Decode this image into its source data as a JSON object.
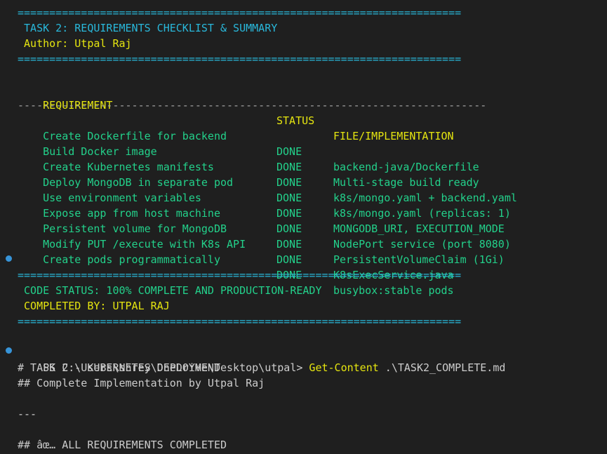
{
  "colors": {
    "background": "#1f1f1f",
    "cyan": "#29b8db",
    "yellow": "#e5e510",
    "green": "#23d18b",
    "text": "#cccccc",
    "dot": "#3794d8"
  },
  "banner": {
    "separator": "======================================================================",
    "title": " TASK 2: REQUIREMENTS CHECKLIST & SUMMARY",
    "author": " Author: Utpal Raj"
  },
  "table": {
    "headers": {
      "requirement": "REQUIREMENT",
      "status": "STATUS",
      "file": "FILE/IMPLEMENTATION"
    },
    "divider": "--------------------------------------------------------------------------",
    "rows": [
      {
        "requirement": "Create Dockerfile for backend",
        "status": "DONE",
        "file": "backend-java/Dockerfile"
      },
      {
        "requirement": "Build Docker image",
        "status": "DONE",
        "file": "Multi-stage build ready"
      },
      {
        "requirement": "Create Kubernetes manifests",
        "status": "DONE",
        "file": "k8s/mongo.yaml + backend.yaml"
      },
      {
        "requirement": "Deploy MongoDB in separate pod",
        "status": "DONE",
        "file": "k8s/mongo.yaml (replicas: 1)"
      },
      {
        "requirement": "Use environment variables",
        "status": "DONE",
        "file": "MONGODB_URI, EXECUTION_MODE"
      },
      {
        "requirement": "Expose app from host machine",
        "status": "DONE",
        "file": "NodePort service (port 8080)"
      },
      {
        "requirement": "Persistent volume for MongoDB",
        "status": "DONE",
        "file": "PersistentVolumeClaim (1Gi)"
      },
      {
        "requirement": "Modify PUT /execute with K8s API",
        "status": "DONE",
        "file": "K8sExecService.java"
      },
      {
        "requirement": "Create pods programmatically",
        "status": "DONE",
        "file": "busybox:stable pods"
      }
    ]
  },
  "summary": {
    "separator": "======================================================================",
    "code_status": " CODE STATUS: 100% COMPLETE AND PRODUCTION-READY",
    "completed_by": " COMPLETED BY: UTPAL RAJ"
  },
  "prompt": {
    "path": "PS C:\\Users\\shrey\\OneDrive\\Desktop\\utpal> ",
    "command": "Get-Content",
    "argument": " .\\TASK2_COMPLETE.md"
  },
  "output": {
    "line1": "# TASK 2 - KUBERNETES DEPLOYMENT",
    "line2": "## Complete Implementation by Utpal Raj",
    "line3": "---",
    "line4": "## âœ… ALL REQUIREMENTS COMPLETED"
  }
}
